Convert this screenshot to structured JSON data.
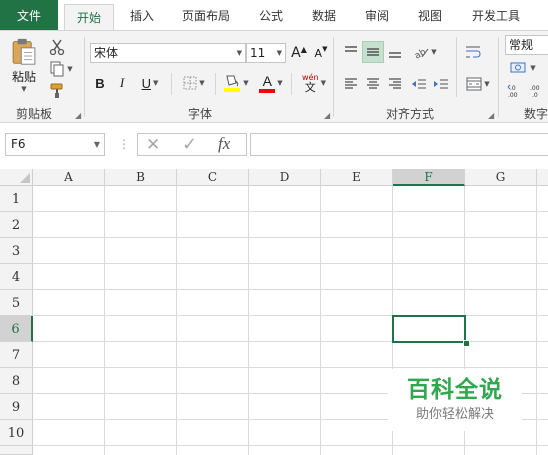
{
  "ribbon_tabs": [
    "文件",
    "开始",
    "插入",
    "页面布局",
    "公式",
    "数据",
    "审阅",
    "视图",
    "开发工具"
  ],
  "active_tab": "开始",
  "clipboard": {
    "paste_label": "粘贴",
    "group_label": "剪贴板"
  },
  "font": {
    "name": "宋体",
    "size": "11",
    "bold_label": "B",
    "italic_label": "I",
    "underline_label": "U",
    "grow_label": "A",
    "shrink_label": "A",
    "color_label": "A",
    "phonetic_label": "wén",
    "phonetic_char": "文",
    "group_label": "字体"
  },
  "alignment": {
    "group_label": "对齐方式"
  },
  "number": {
    "format": "常规",
    "group_label": "数字"
  },
  "formula_bar": {
    "name_box": "F6",
    "dots": "⋮",
    "cancel_symbol": "✕",
    "enter_symbol": "✓",
    "fx_label": "fx",
    "formula": ""
  },
  "sheet": {
    "columns": [
      "A",
      "B",
      "C",
      "D",
      "E",
      "F",
      "G"
    ],
    "rows": [
      "1",
      "2",
      "3",
      "4",
      "5",
      "6",
      "7",
      "8",
      "9",
      "10"
    ],
    "selected_column": "F",
    "selected_row": "6"
  },
  "watermark": {
    "title": "百科全说",
    "subtitle": "助你轻松解决"
  },
  "colors": {
    "accent": "#217346",
    "highlight": "#ffff00",
    "font_color": "#ff0000",
    "watermark": "#31a84f"
  }
}
